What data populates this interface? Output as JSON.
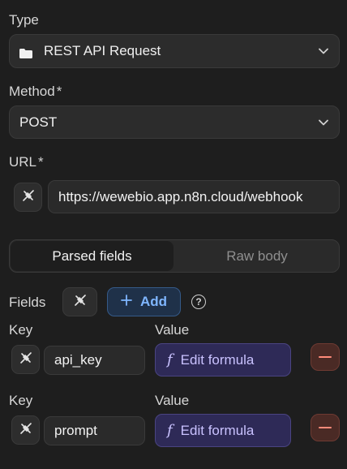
{
  "type_section": {
    "label": "Type",
    "value": "REST API Request",
    "icon": "folder-icon"
  },
  "method_section": {
    "label": "Method",
    "required_mark": "*",
    "value": "POST"
  },
  "url_section": {
    "label": "URL",
    "required_mark": "*",
    "value": "https://wewebio.app.n8n.cloud/webhook"
  },
  "body_tabs": [
    {
      "label": "Parsed fields",
      "active": true
    },
    {
      "label": "Raw body",
      "active": false
    }
  ],
  "fields": {
    "label": "Fields",
    "add_label": "Add",
    "rows": [
      {
        "key_label": "Key",
        "value_label": "Value",
        "key": "api_key",
        "value_button": "Edit formula"
      },
      {
        "key_label": "Key",
        "value_label": "Value",
        "key": "prompt",
        "value_button": "Edit formula"
      }
    ]
  },
  "colors": {
    "background": "#1e1e1e",
    "formula_accent": "#c9c2ff",
    "add_accent": "#7fb6ff",
    "remove_accent": "#ff8b7a"
  }
}
